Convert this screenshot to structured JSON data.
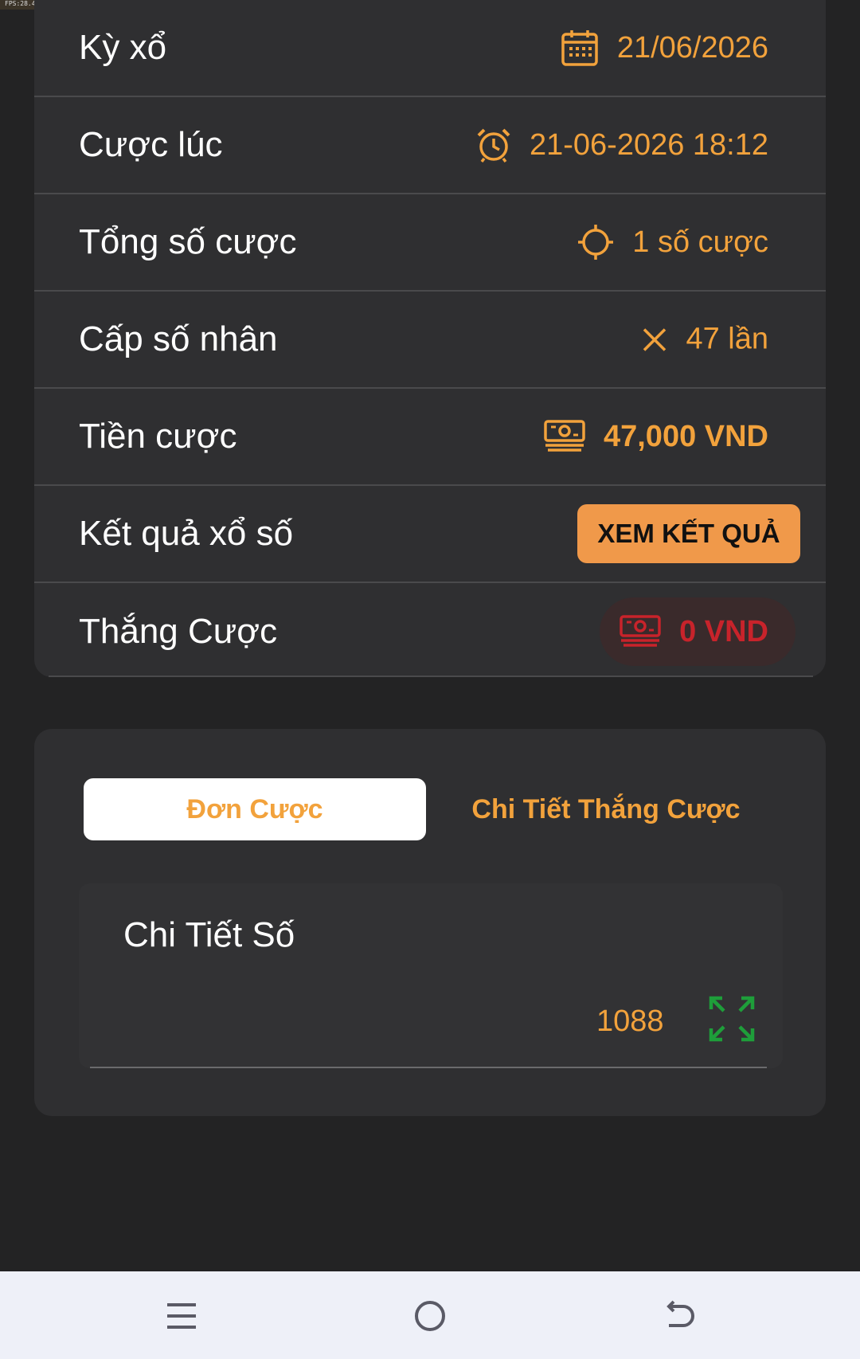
{
  "status_strip": {
    "fps_text": "FPS:28.4"
  },
  "details": {
    "draw": {
      "label": "Kỳ xổ",
      "value": "21/06/2026",
      "icon": "calendar-icon"
    },
    "bet_time": {
      "label": "Cược lúc",
      "value": "21-06-2026 18:12",
      "icon": "alarm-clock-icon"
    },
    "total_bets": {
      "label": "Tổng số cược",
      "value": "1 số cược",
      "icon": "crosshair-icon"
    },
    "multiplier": {
      "label": "Cấp số nhân",
      "value": "47 lần",
      "icon": "multiply-icon"
    },
    "stake": {
      "label": "Tiền cược",
      "value": "47,000 VND",
      "icon": "money-stack-icon"
    },
    "result": {
      "label": "Kết quả xổ số",
      "button": "XEM KẾT QUẢ"
    },
    "winnings": {
      "label": "Thắng Cược",
      "value": "0 VND",
      "icon": "money-stack-icon"
    }
  },
  "tabs": [
    {
      "label": "Đơn Cược",
      "active": true
    },
    {
      "label": "Chi Tiết Thắng Cược",
      "active": false
    }
  ],
  "number_detail": {
    "title": "Chi Tiết Số",
    "number": "1088",
    "icon": "expand-icon"
  },
  "nav": {
    "menu": "menu-icon",
    "home": "home-icon",
    "back": "back-icon"
  },
  "colors": {
    "accent": "#f2a23c",
    "button": "#f0994a",
    "loss": "#c8232b",
    "expand": "#1e9e3a",
    "background": "#232324",
    "card": "#2f2f31"
  }
}
